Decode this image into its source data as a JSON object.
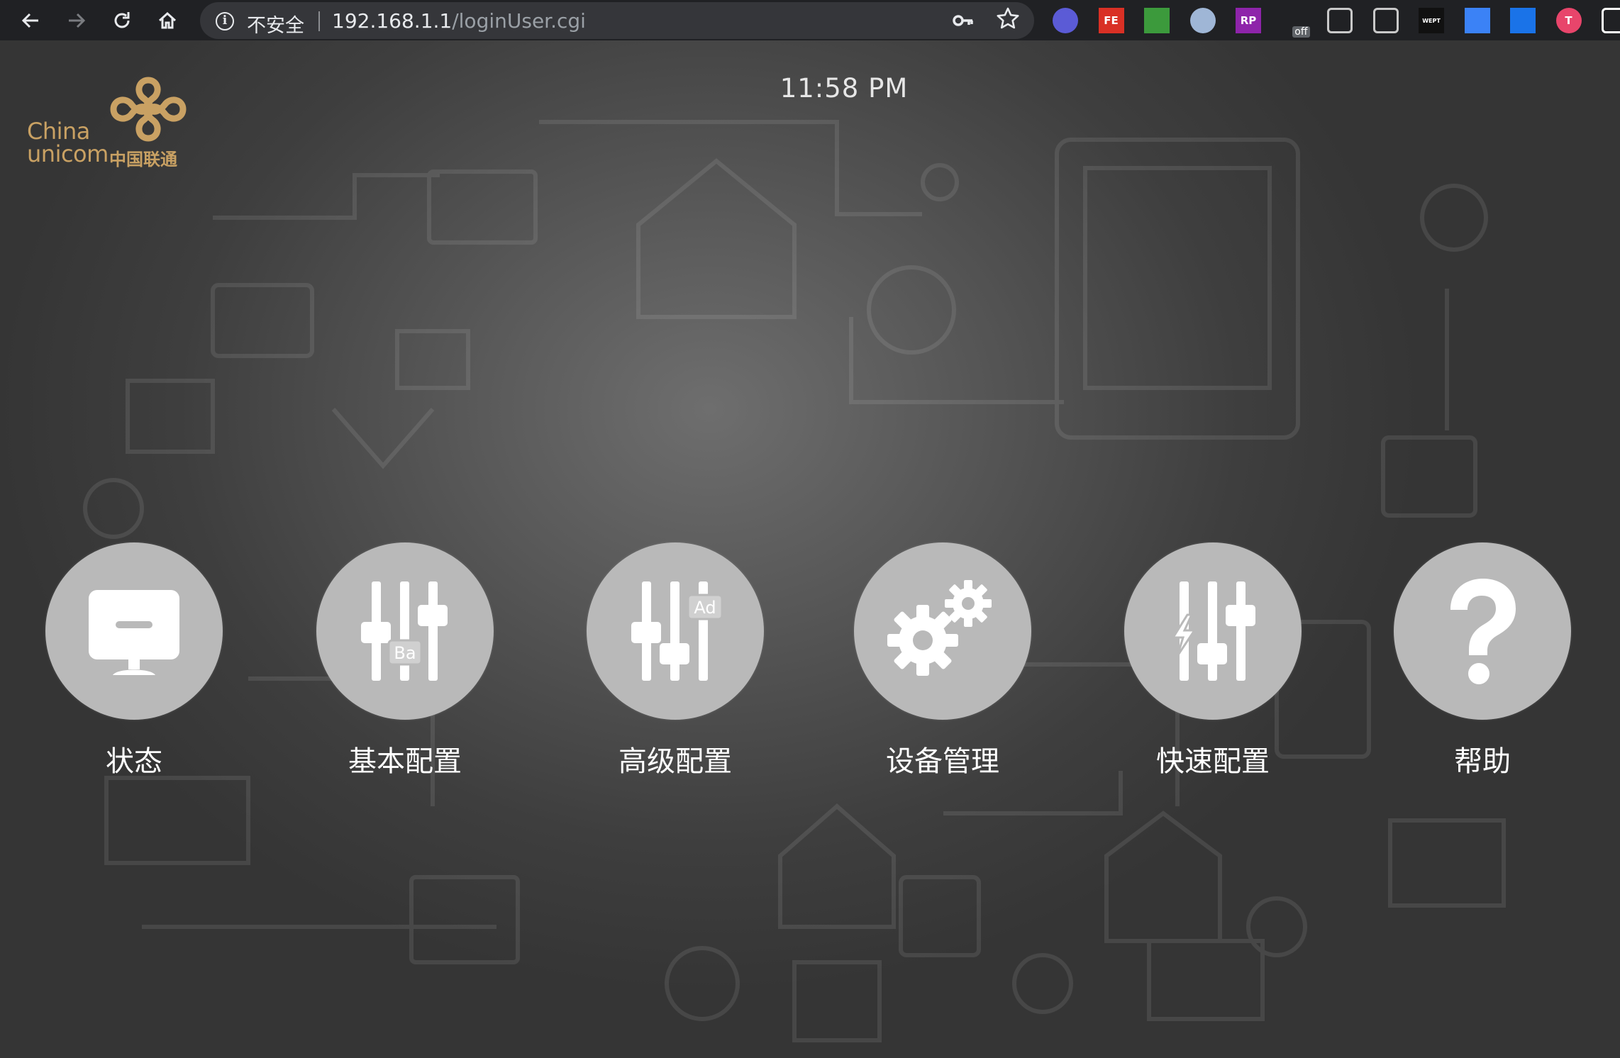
{
  "browser": {
    "security_label": "不安全",
    "url_host": "192.168.1.1",
    "url_path": "/loginUser.cgi",
    "extensions": [
      {
        "name": "extension-check-icon",
        "text": "",
        "color": "#5b5bd6"
      },
      {
        "name": "extension-fe-icon",
        "text": "FE",
        "color": "#d93025"
      },
      {
        "name": "extension-arrow-icon",
        "text": "",
        "color": "#3c9a3c"
      },
      {
        "name": "extension-ring-icon",
        "text": "",
        "color": "#9fb6d6"
      },
      {
        "name": "extension-rp-icon",
        "text": "RP",
        "color": "#8e24aa"
      },
      {
        "name": "extension-off-icon",
        "text": "off",
        "color": "#202124"
      },
      {
        "name": "extension-pocket-icon",
        "text": "",
        "color": "#c9c9c9"
      },
      {
        "name": "extension-v-icon",
        "text": "",
        "color": "#c9c9c9"
      },
      {
        "name": "extension-wept-icon",
        "text": "WEPT",
        "color": "#111111"
      },
      {
        "name": "extension-diamond-icon",
        "text": "",
        "color": "#3b82f6"
      },
      {
        "name": "extension-blue-icon",
        "text": "",
        "color": "#1a73e8"
      },
      {
        "name": "extension-red-t-icon",
        "text": "T",
        "color": "#e8456b"
      },
      {
        "name": "extension-square-icon",
        "text": "",
        "color": "#ffffff"
      }
    ]
  },
  "header": {
    "logo_en_line1": "China",
    "logo_en_line2": "unicom",
    "logo_cn": "中国联通",
    "time": "11:58 PM"
  },
  "menu": [
    {
      "label": "状态",
      "icon": "monitor-icon"
    },
    {
      "label": "基本配置",
      "icon": "basic-sliders-icon",
      "badge": "Ba"
    },
    {
      "label": "高级配置",
      "icon": "advanced-sliders-icon",
      "badge": "Ad"
    },
    {
      "label": "设备管理",
      "icon": "gears-icon"
    },
    {
      "label": "快速配置",
      "icon": "quick-sliders-icon"
    },
    {
      "label": "帮助",
      "icon": "help-icon",
      "symbol": "?"
    }
  ],
  "colors": {
    "logo_gold": "#c9a163",
    "circle_gray": "#b9b9b9",
    "icon_white": "#ffffff"
  }
}
